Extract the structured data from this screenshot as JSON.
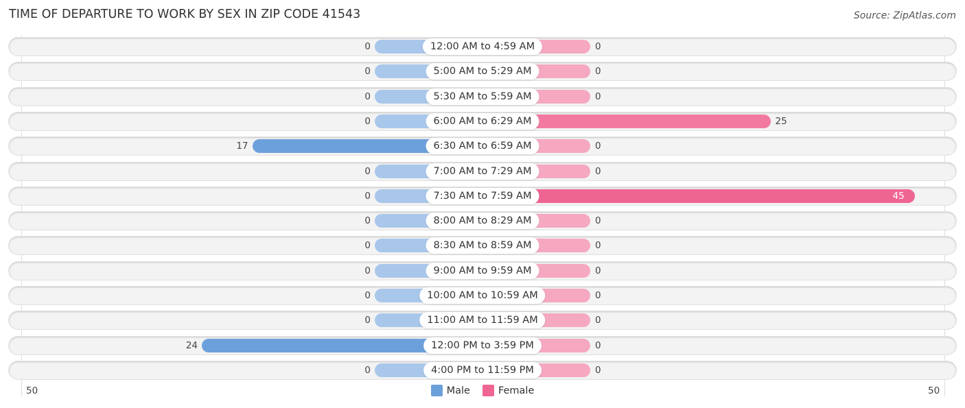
{
  "title": "TIME OF DEPARTURE TO WORK BY SEX IN ZIP CODE 41543",
  "source": "Source: ZipAtlas.com",
  "chart_data": {
    "type": "bar",
    "orientation": "horizontal-diverging",
    "title": "TIME OF DEPARTURE TO WORK BY SEX IN ZIP CODE 41543",
    "categories": [
      "12:00 AM to 4:59 AM",
      "5:00 AM to 5:29 AM",
      "5:30 AM to 5:59 AM",
      "6:00 AM to 6:29 AM",
      "6:30 AM to 6:59 AM",
      "7:00 AM to 7:29 AM",
      "7:30 AM to 7:59 AM",
      "8:00 AM to 8:29 AM",
      "8:30 AM to 8:59 AM",
      "9:00 AM to 9:59 AM",
      "10:00 AM to 10:59 AM",
      "11:00 AM to 11:59 AM",
      "12:00 PM to 3:59 PM",
      "4:00 PM to 11:59 PM"
    ],
    "series": [
      {
        "name": "Male",
        "color": "#6ca0db",
        "values": [
          0,
          0,
          0,
          0,
          17,
          0,
          0,
          0,
          0,
          0,
          0,
          0,
          24,
          0
        ]
      },
      {
        "name": "Female",
        "color": "#f27aa0",
        "values": [
          0,
          0,
          0,
          25,
          0,
          0,
          45,
          0,
          0,
          0,
          0,
          0,
          0,
          0
        ]
      }
    ],
    "axis": {
      "min_label": "50",
      "max_label": "50",
      "range": [
        -50,
        50
      ]
    },
    "legend": {
      "position": "bottom-center",
      "entries": [
        "Male",
        "Female"
      ]
    },
    "grid": false
  },
  "colors": {
    "male": "#6ca0db",
    "male_zero": "#a9c7ea",
    "female": "#f27aa0",
    "female_zero": "#f5a8c0",
    "female_strong": "#ef6592"
  }
}
